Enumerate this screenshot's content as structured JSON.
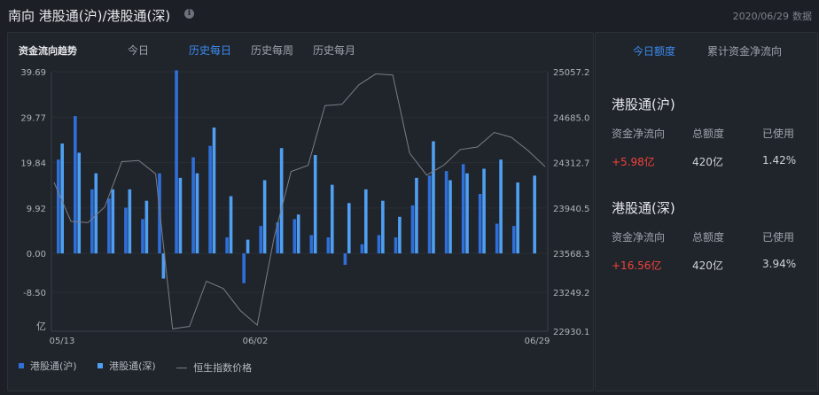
{
  "header": {
    "title": "南向 港股通(沪)/港股通(深)",
    "date": "2020/06/29",
    "date_suffix": "数据"
  },
  "chart_panel": {
    "heading": "资金流向趋势",
    "tabs": [
      "今日",
      "历史每日",
      "历史每周",
      "历史每月"
    ],
    "active_tab": "历史每日"
  },
  "chart_data": {
    "type": "bar",
    "categories_labeled": [
      "05/13",
      "06/02",
      "06/29"
    ],
    "y_left_ticks": [
      "39.69",
      "29.77",
      "19.84",
      "9.92",
      "0.00",
      "-8.50"
    ],
    "y_left_unit": "亿",
    "y_right_ticks": [
      "25057.2",
      "24685.0",
      "24312.7",
      "23940.5",
      "23568.3",
      "23249.2",
      "22930.1"
    ],
    "y_left_range": [
      -17.0,
      39.69
    ],
    "y_right_range": [
      22930.1,
      25057.2
    ],
    "series": [
      {
        "name": "港股通(沪)",
        "color": "#2f6fd9",
        "values": [
          20.5,
          30.0,
          14.0,
          12.0,
          10.0,
          7.5,
          17.5,
          40.0,
          21.0,
          23.5,
          3.5,
          -6.5,
          6.0,
          6.8,
          7.5,
          4.0,
          3.5,
          -2.5,
          2.0,
          4.0,
          3.5,
          10.5,
          17.0,
          18.0,
          19.5,
          13.0,
          6.5,
          6.0
        ]
      },
      {
        "name": "港股通(深)",
        "color": "#4fa0f2",
        "values": [
          24.0,
          22.0,
          17.5,
          14.0,
          14.0,
          11.5,
          -5.5,
          16.5,
          17.5,
          27.5,
          12.5,
          3.0,
          16.0,
          23.0,
          8.5,
          21.5,
          15.0,
          11.0,
          14.0,
          11.5,
          8.0,
          16.5,
          24.5,
          16.0,
          17.5,
          18.5,
          20.5,
          15.5,
          17.0
        ]
      },
      {
        "name": "恒生指数价格",
        "color": "#7a7e86",
        "values": [
          24150,
          23830,
          23820,
          23950,
          24320,
          24330,
          24220,
          22950,
          22970,
          23340,
          23280,
          23100,
          22980,
          23700,
          24240,
          24290,
          24780,
          24790,
          24950,
          25040,
          25030,
          24390,
          24210,
          24290,
          24420,
          24440,
          24560,
          24520,
          24410,
          24280
        ]
      }
    ]
  },
  "side_panel": {
    "tabs": [
      "今日额度",
      "累计资金净流向"
    ],
    "active_tab": "今日额度",
    "sh": {
      "title": "港股通(沪)",
      "headers": [
        "资金净流向",
        "总额度",
        "已使用"
      ],
      "values": [
        "+5.98亿",
        "420亿",
        "1.42%"
      ]
    },
    "sz": {
      "title": "港股通(深)",
      "headers": [
        "资金净流向",
        "总额度",
        "已使用"
      ],
      "values": [
        "+16.56亿",
        "420亿",
        "3.94%"
      ]
    }
  }
}
